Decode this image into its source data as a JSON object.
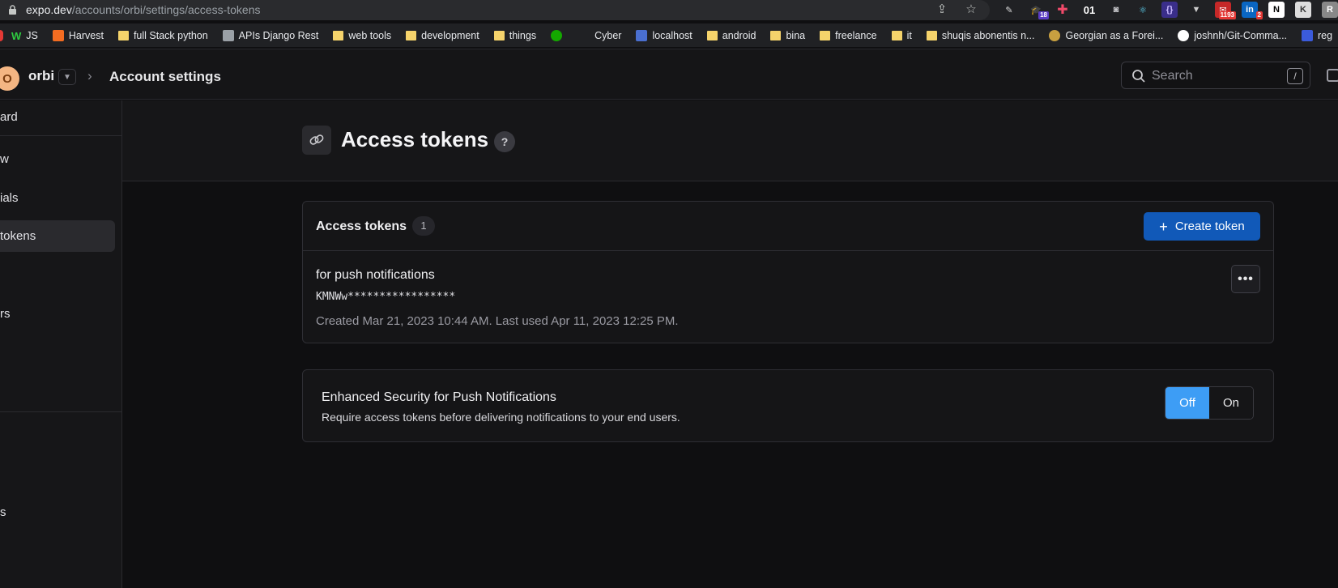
{
  "browser": {
    "url_host": "expo.dev",
    "url_path": "/accounts/orbi/settings/access-tokens",
    "ext_number_label": "01",
    "badges": [
      "18",
      "1193",
      "2"
    ],
    "bookmarks": [
      {
        "label": "JS",
        "icon": "w-icon"
      },
      {
        "label": "Harvest",
        "icon": "harvest-icon"
      },
      {
        "label": "full Stack python",
        "icon": "folder-icon"
      },
      {
        "label": "APIs Django Rest",
        "icon": "page-icon"
      },
      {
        "label": "web tools",
        "icon": "folder-icon"
      },
      {
        "label": "development",
        "icon": "folder-icon"
      },
      {
        "label": "things",
        "icon": "folder-icon"
      },
      {
        "label": "",
        "icon": "upwork-icon"
      },
      {
        "label": "Cyber",
        "icon": "none"
      },
      {
        "label": "localhost",
        "icon": "db-icon"
      },
      {
        "label": "android",
        "icon": "folder-icon"
      },
      {
        "label": "bina",
        "icon": "folder-icon"
      },
      {
        "label": "freelance",
        "icon": "folder-icon"
      },
      {
        "label": "it",
        "icon": "folder-icon"
      },
      {
        "label": "shuqis abonentis n...",
        "icon": "folder-icon"
      },
      {
        "label": "Georgian as a Forei...",
        "icon": "site-icon"
      },
      {
        "label": "joshnh/Git-Comma...",
        "icon": "github-icon"
      },
      {
        "label": "reg",
        "icon": "r-icon"
      }
    ]
  },
  "header": {
    "avatar_letter": "O",
    "org_name": "orbi",
    "breadcrumb": "Account settings",
    "search_placeholder": "Search",
    "search_shortcut": "/"
  },
  "sidebar": {
    "items": [
      {
        "label": "ard"
      },
      {
        "label": "w"
      },
      {
        "label": "ials"
      },
      {
        "label": "tokens"
      },
      {
        "label": "rs"
      },
      {
        "label": "s"
      }
    ]
  },
  "page": {
    "title": "Access tokens",
    "help": "?"
  },
  "tokens_card": {
    "title": "Access tokens",
    "count": "1",
    "create_label": "Create token",
    "create_plus": "+",
    "tokens": [
      {
        "name": "for push notifications",
        "value": "KMNWw*****************",
        "meta": "Created Mar 21, 2023 10:44 AM. Last used Apr 11, 2023 12:25 PM."
      }
    ],
    "more_label": "•••"
  },
  "security_card": {
    "title": "Enhanced Security for Push Notifications",
    "description": "Require access tokens before delivering notifications to your end users.",
    "off_label": "Off",
    "on_label": "On",
    "selected": "Off"
  },
  "colors": {
    "accent": "#1159b8",
    "toggle_active": "#3d9df5",
    "avatar": "#f4b683"
  }
}
